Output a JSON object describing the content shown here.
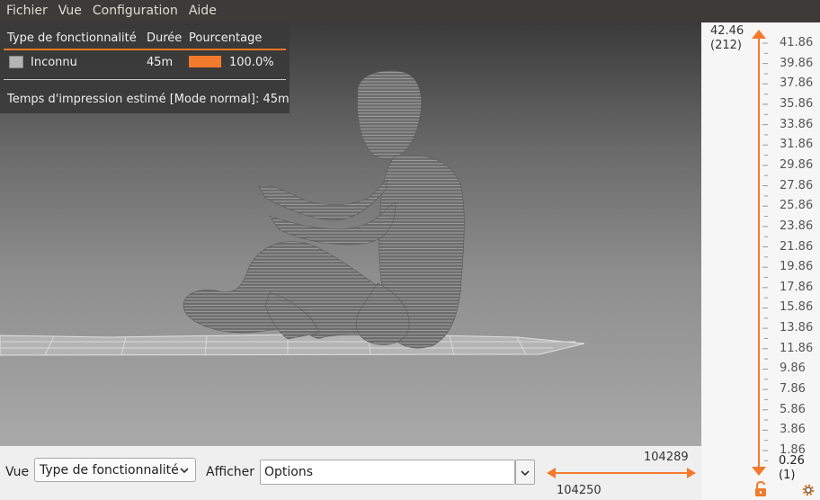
{
  "menubar": {
    "items": [
      "Fichier",
      "Vue",
      "Configuration",
      "Aide"
    ]
  },
  "legend": {
    "col_type": "Type de fonctionnalité",
    "col_duration": "Durée",
    "col_percentage": "Pourcentage",
    "row": {
      "type": "Inconnu",
      "duration": "45m",
      "percentage": "100.0%",
      "bar_color": "#f47a2c",
      "swatch_color": "#b5b5b5"
    },
    "estimate_label": "Temps d'impression estimé [Mode normal]:",
    "estimate_value": "45m"
  },
  "bottombar": {
    "view_label": "Vue",
    "view_select_value": "Type de fonctionnalité",
    "show_label": "Afficher",
    "options_value": "Options",
    "hslider_right_value": "104289",
    "hslider_left_value": "104250"
  },
  "layer_slider": {
    "top_height": "42.46",
    "top_layer": "(212)",
    "bottom_height": "0.26",
    "bottom_layer": "(1)",
    "ticks": [
      "41.86",
      "39.86",
      "37.86",
      "35.86",
      "33.86",
      "31.86",
      "29.86",
      "27.86",
      "25.86",
      "23.86",
      "21.86",
      "19.86",
      "17.86",
      "15.86",
      "13.86",
      "11.86",
      "9.86",
      "7.86",
      "5.86",
      "3.86",
      "1.86"
    ]
  },
  "colors": {
    "accent": "#f47a2c",
    "menubar_bg": "#3c3b37",
    "model_grey": "#707070"
  },
  "icons": {
    "lock": "lock-open-icon",
    "settings": "cog-icon",
    "dropdown": "chevron-down-icon"
  }
}
